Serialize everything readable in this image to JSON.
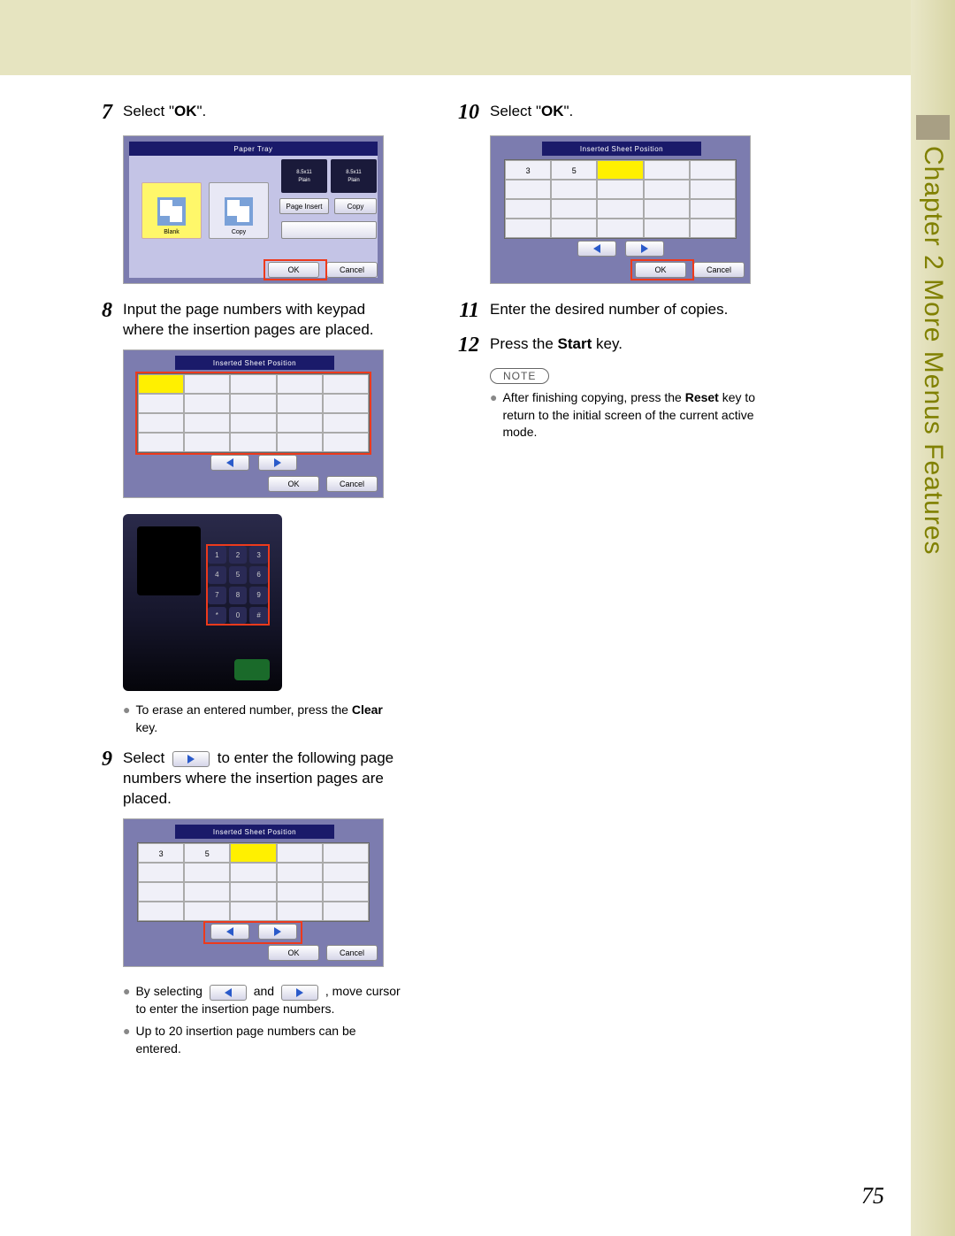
{
  "sidebar": {
    "label": "Chapter 2    More Menus Features"
  },
  "page_number": "75",
  "steps": {
    "s7": {
      "num": "7",
      "text_a": "Select \"",
      "bold": "OK",
      "text_b": "\"."
    },
    "s8": {
      "num": "8",
      "text": "Input the page numbers with keypad where the insertion pages are placed."
    },
    "s8_note_a": "To erase an entered number, press the ",
    "s8_note_bold": "Clear",
    "s8_note_b": " key.",
    "s9": {
      "num": "9",
      "text_a": "Select ",
      "text_b": " to enter the following page numbers where the insertion pages are placed."
    },
    "s9_note1_a": "By selecting ",
    "s9_note1_b": " and ",
    "s9_note1_c": " , move cursor to enter the insertion page numbers.",
    "s9_note2": "Up to 20 insertion page numbers can be entered.",
    "s10": {
      "num": "10",
      "text_a": "Select \"",
      "bold": "OK",
      "text_b": "\"."
    },
    "s11": {
      "num": "11",
      "text": "Enter the desired number of copies."
    },
    "s12": {
      "num": "12",
      "text_a": "Press the ",
      "bold": "Start",
      "text_b": " key."
    },
    "s12_note_label": "NOTE",
    "s12_note_a": "After finishing copying, press the ",
    "s12_note_bold": "Reset",
    "s12_note_b": " key to return to the initial screen of the current active mode."
  },
  "ss7": {
    "title": "Paper Tray",
    "opt1": "Blank",
    "opt2": "Copy",
    "dark1a": "8.5x11",
    "dark1b": "Plain",
    "dark2a": "8.5x11",
    "dark2b": "Plain",
    "btn_page_insert": "Page Insert",
    "btn_copy": "Copy",
    "ok": "OK",
    "cancel": "Cancel"
  },
  "ss8": {
    "title": "Inserted Sheet Position",
    "ok": "OK",
    "cancel": "Cancel"
  },
  "ss9": {
    "title": "Inserted Sheet Position",
    "cell1": "3",
    "cell2": "5",
    "ok": "OK",
    "cancel": "Cancel"
  },
  "ss10": {
    "title": "Inserted Sheet Position",
    "cell1": "3",
    "cell2": "5",
    "ok": "OK",
    "cancel": "Cancel"
  },
  "keypad": [
    "1",
    "2",
    "3",
    "4",
    "5",
    "6",
    "7",
    "8",
    "9",
    "*",
    "0",
    "#"
  ]
}
